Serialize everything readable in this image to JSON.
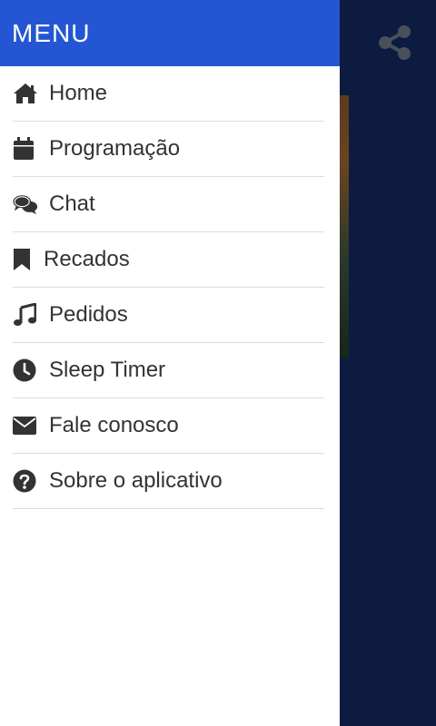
{
  "drawer": {
    "title": "MENU",
    "items": [
      {
        "label": "Home",
        "icon": "home-icon"
      },
      {
        "label": "Programação",
        "icon": "calendar-icon"
      },
      {
        "label": "Chat",
        "icon": "chat-icon"
      },
      {
        "label": "Recados",
        "icon": "bookmark-icon"
      },
      {
        "label": "Pedidos",
        "icon": "music-note-icon"
      },
      {
        "label": "Sleep Timer",
        "icon": "clock-icon"
      },
      {
        "label": "Fale conosco",
        "icon": "envelope-icon"
      },
      {
        "label": "Sobre o aplicativo",
        "icon": "question-circle-icon"
      }
    ]
  },
  "topbar": {
    "share_icon": "share-icon"
  },
  "colors": {
    "header_bg": "#2456d3",
    "app_bg": "#0d1b40",
    "text": "#333333",
    "divider": "#dcdcdc"
  }
}
